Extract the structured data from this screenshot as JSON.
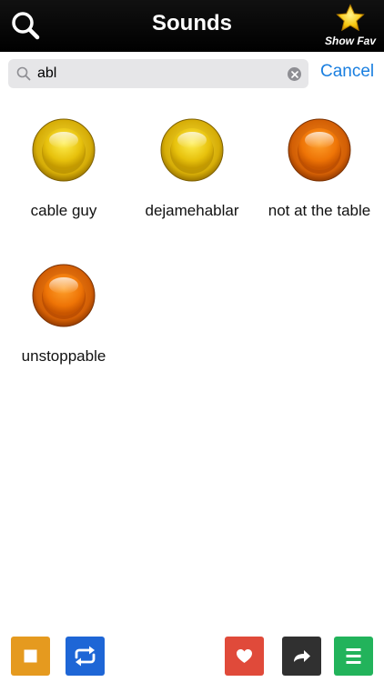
{
  "header": {
    "title": "Sounds",
    "fav_label": "Show Fav",
    "search_icon": "search-icon",
    "fav_icon": "star-icon"
  },
  "search": {
    "value": "abl",
    "placeholder": "",
    "cancel_label": "Cancel",
    "accent": "#1a7fe0"
  },
  "sounds": [
    {
      "label": "cable guy",
      "color": "yellow"
    },
    {
      "label": "dejamehablar",
      "color": "yellow"
    },
    {
      "label": "not at the table",
      "color": "orange"
    },
    {
      "label": "unstoppable",
      "color": "orange"
    }
  ],
  "toolbar": {
    "stop": {
      "icon": "stop-icon",
      "color": "#e59a1f"
    },
    "loop": {
      "icon": "repeat-icon",
      "color": "#1e66d6"
    },
    "favorite": {
      "icon": "heart-icon",
      "color": "#e04a3a"
    },
    "share": {
      "icon": "share-arrow-icon",
      "color": "#303030"
    },
    "menu": {
      "icon": "menu-icon",
      "color": "#22b35b"
    }
  }
}
